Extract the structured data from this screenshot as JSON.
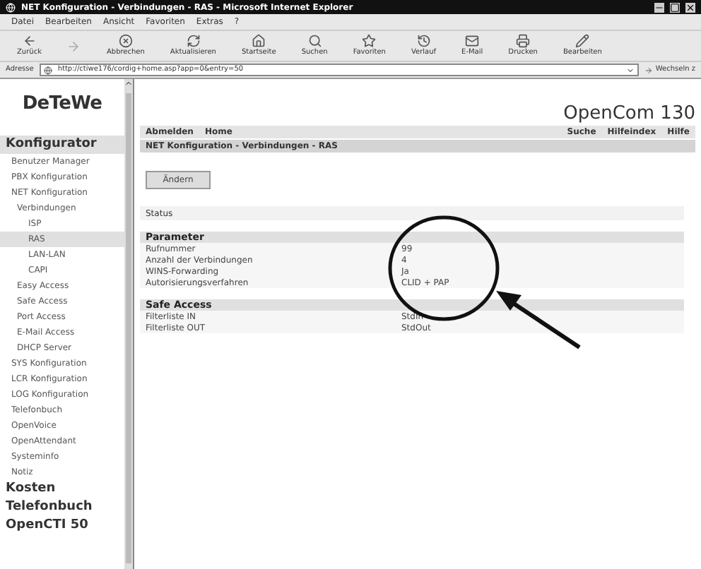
{
  "window": {
    "title": "NET Konfiguration - Verbindungen - RAS - Microsoft Internet Explorer"
  },
  "menu": [
    "Datei",
    "Bearbeiten",
    "Ansicht",
    "Favoriten",
    "Extras",
    "?"
  ],
  "toolbar": [
    {
      "label": "Zurück",
      "disabled": false,
      "kind": "back"
    },
    {
      "disabled": true,
      "kind": "forward"
    },
    {
      "label": "Abbrechen",
      "disabled": false,
      "kind": "stop"
    },
    {
      "label": "Aktualisieren",
      "disabled": false,
      "kind": "refresh"
    },
    {
      "label": "Startseite",
      "disabled": false,
      "kind": "home"
    },
    {
      "label": "Suchen",
      "disabled": false,
      "kind": "search"
    },
    {
      "label": "Favoriten",
      "disabled": false,
      "kind": "favorites"
    },
    {
      "label": "Verlauf",
      "disabled": false,
      "kind": "history"
    },
    {
      "label": "E-Mail",
      "disabled": false,
      "kind": "mail"
    },
    {
      "label": "Drucken",
      "disabled": false,
      "kind": "print"
    },
    {
      "label": "Bearbeiten",
      "disabled": false,
      "kind": "edit"
    }
  ],
  "address": {
    "label": "Adresse",
    "value": "http://ctiwe176/cordig+home.asp?app=0&entry=50",
    "go": "Wechseln z"
  },
  "sidebar": {
    "logo": "DeTeWe",
    "sections": [
      {
        "label": "Konfigurator",
        "selected": true,
        "children": [
          {
            "label": "Benutzer Manager",
            "selected": false
          },
          {
            "label": "PBX Konfiguration",
            "selected": false
          },
          {
            "label": "NET Konfiguration",
            "selected": false,
            "children": [
              {
                "label": "Verbindungen",
                "selected": false,
                "children": [
                  {
                    "label": "ISP",
                    "selected": false
                  },
                  {
                    "label": "RAS",
                    "selected": true
                  },
                  {
                    "label": "LAN-LAN",
                    "selected": false
                  },
                  {
                    "label": "CAPI",
                    "selected": false
                  }
                ]
              },
              {
                "label": "Easy Access",
                "selected": false
              },
              {
                "label": "Safe Access",
                "selected": false
              },
              {
                "label": "Port Access",
                "selected": false
              },
              {
                "label": "E-Mail Access",
                "selected": false
              },
              {
                "label": "DHCP Server",
                "selected": false
              }
            ]
          },
          {
            "label": "SYS Konfiguration",
            "selected": false
          },
          {
            "label": "LCR Konfiguration",
            "selected": false
          },
          {
            "label": "LOG Konfiguration",
            "selected": false
          },
          {
            "label": "Telefonbuch",
            "selected": false
          },
          {
            "label": "OpenVoice",
            "selected": false
          },
          {
            "label": "OpenAttendant",
            "selected": false
          },
          {
            "label": "Systeminfo",
            "selected": false
          },
          {
            "label": "Notiz",
            "selected": false
          }
        ]
      },
      {
        "label": "Kosten",
        "selected": false
      },
      {
        "label": "Telefonbuch",
        "selected": false
      },
      {
        "label": "OpenCTI 50",
        "selected": false
      }
    ]
  },
  "brand": "OpenCom 130",
  "nav_left": [
    "Abmelden",
    "Home"
  ],
  "nav_right": [
    "Suche",
    "Hilfeindex",
    "Hilfe"
  ],
  "breadcrumb": "NET Konfiguration - Verbindungen - RAS",
  "change_button": "Ändern",
  "status_label": "Status",
  "sections": [
    {
      "title": "Parameter",
      "rows": [
        {
          "label": "Rufnummer",
          "value": "99"
        },
        {
          "label": "Anzahl der Verbindungen",
          "value": "4"
        },
        {
          "label": "WINS-Forwarding",
          "value": "Ja"
        },
        {
          "label": "Autorisierungsverfahren",
          "value": "CLID + PAP"
        }
      ]
    },
    {
      "title": "Safe Access",
      "rows": [
        {
          "label": "Filterliste IN",
          "value": "StdIn"
        },
        {
          "label": "Filterliste OUT",
          "value": "StdOut"
        }
      ]
    }
  ]
}
